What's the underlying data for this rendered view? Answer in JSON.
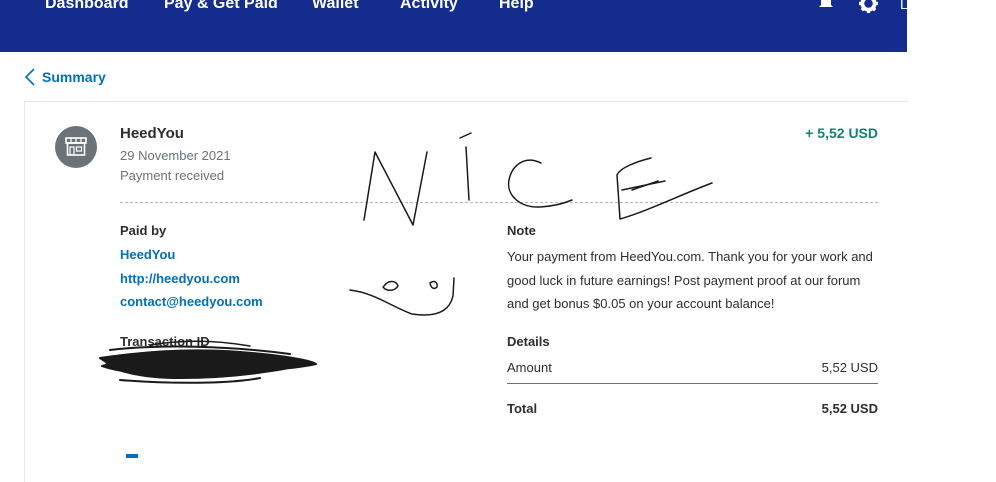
{
  "nav": {
    "items": [
      "Dashboard",
      "Pay & Get Paid",
      "Wallet",
      "Activity",
      "Help"
    ],
    "trailing_stub": "L"
  },
  "back": {
    "label": "Summary"
  },
  "transaction": {
    "merchant": "HeedYou",
    "date": "29 November 2021",
    "status": "Payment received",
    "amount": "+ 5,52 USD"
  },
  "paid_by": {
    "heading": "Paid by",
    "name": "HeedYou",
    "website": "http://heedyou.com",
    "email": "contact@heedyou.com"
  },
  "transaction_id": {
    "heading": "Transaction ID"
  },
  "note": {
    "heading": "Note",
    "text": "Your payment from HeedYou.com. Thank you for your work and good luck in future earnings! Post payment proof at our forum and get bonus $0.05 on your account balance!"
  },
  "details": {
    "heading": "Details",
    "amount_label": "Amount",
    "amount_value": "5,52 USD",
    "total_label": "Total",
    "total_value": "5,52 USD"
  },
  "annotation": {
    "handwritten": "NiCE"
  },
  "colors": {
    "nav_bg": "#142c8e",
    "link": "#0070ba",
    "positive": "#108474",
    "avatar_bg": "#6c7378"
  }
}
